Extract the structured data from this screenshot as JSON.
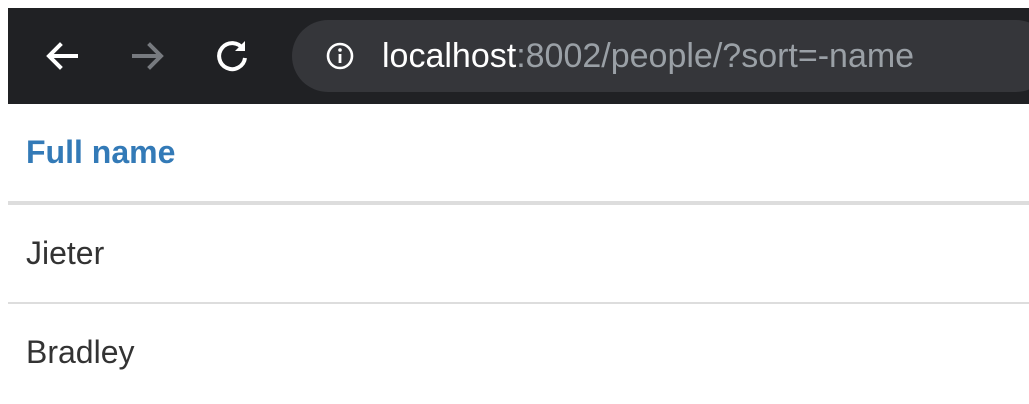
{
  "browser": {
    "url_host": "localhost",
    "url_rest": ":8002/people/?sort=-name",
    "icons": {
      "back": "arrow-left-icon",
      "forward": "arrow-right-icon",
      "reload": "reload-icon",
      "site_info": "info-icon"
    },
    "colors": {
      "toolbar": "#202124",
      "omnibox": "#35363a",
      "url_host": "#ffffff",
      "url_rest": "#9aa0a6"
    }
  },
  "table": {
    "header": "Full name",
    "rows": [
      {
        "full_name": "Jieter"
      },
      {
        "full_name": "Bradley"
      }
    ],
    "colors": {
      "header_link": "#337ab7",
      "text": "#333333",
      "divider": "#dddddd"
    }
  }
}
